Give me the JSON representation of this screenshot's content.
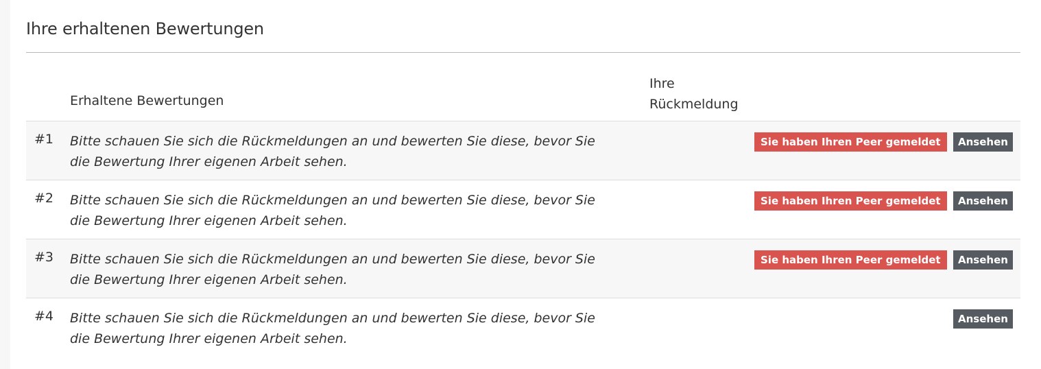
{
  "section": {
    "title": "Ihre erhaltenen Bewertungen"
  },
  "table": {
    "headers": {
      "received": "Erhaltene Bewertungen",
      "feedback": "Ihre Rückmeldung"
    },
    "rows": [
      {
        "number": "#1",
        "text": "Bitte schauen Sie sich die Rückmeldungen an und bewerten Sie diese, bevor Sie die Bewertung Ihrer eigenen Arbeit sehen.",
        "badge": "Sie haben Ihren Peer gemeldet",
        "button": "Ansehen"
      },
      {
        "number": "#2",
        "text": "Bitte schauen Sie sich die Rückmeldungen an und bewerten Sie diese, bevor Sie die Bewertung Ihrer eigenen Arbeit sehen.",
        "badge": "Sie haben Ihren Peer gemeldet",
        "button": "Ansehen"
      },
      {
        "number": "#3",
        "text": "Bitte schauen Sie sich die Rückmeldungen an und bewerten Sie diese, bevor Sie die Bewertung Ihrer eigenen Arbeit sehen.",
        "badge": "Sie haben Ihren Peer gemeldet",
        "button": "Ansehen"
      },
      {
        "number": "#4",
        "text": "Bitte schauen Sie sich die Rückmeldungen an und bewerten Sie diese, bevor Sie die Bewertung Ihrer eigenen Arbeit sehen.",
        "badge": null,
        "button": "Ansehen"
      }
    ]
  },
  "colors": {
    "badge": "#d9534f",
    "button": "#555b61",
    "stripe": "#f7f7f7"
  }
}
